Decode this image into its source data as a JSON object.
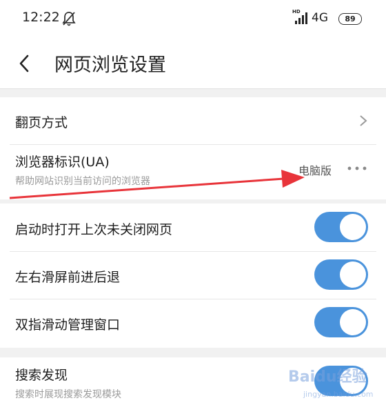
{
  "status_bar": {
    "time": "12:22",
    "network": "4G",
    "hd_label": "HD",
    "battery": "89"
  },
  "header": {
    "title": "网页浏览设置"
  },
  "section1": {
    "page_turn": {
      "label": "翻页方式"
    },
    "ua": {
      "label": "浏览器标识(UA)",
      "description": "帮助网站识别当前访问的浏览器",
      "value": "电脑版"
    }
  },
  "section2": {
    "items": [
      {
        "label": "启动时打开上次未关闭网页",
        "on": true
      },
      {
        "label": "左右滑屏前进后退",
        "on": true
      },
      {
        "label": "双指滑动管理窗口",
        "on": true
      }
    ]
  },
  "section3": {
    "search": {
      "label": "搜索发现",
      "description": "搜索时展现搜索发现模块",
      "on": true
    }
  },
  "watermark": {
    "brand": "Baidu经验",
    "url": "jingyan.baidu.com"
  },
  "annotation": {
    "color": "#e8343a"
  }
}
